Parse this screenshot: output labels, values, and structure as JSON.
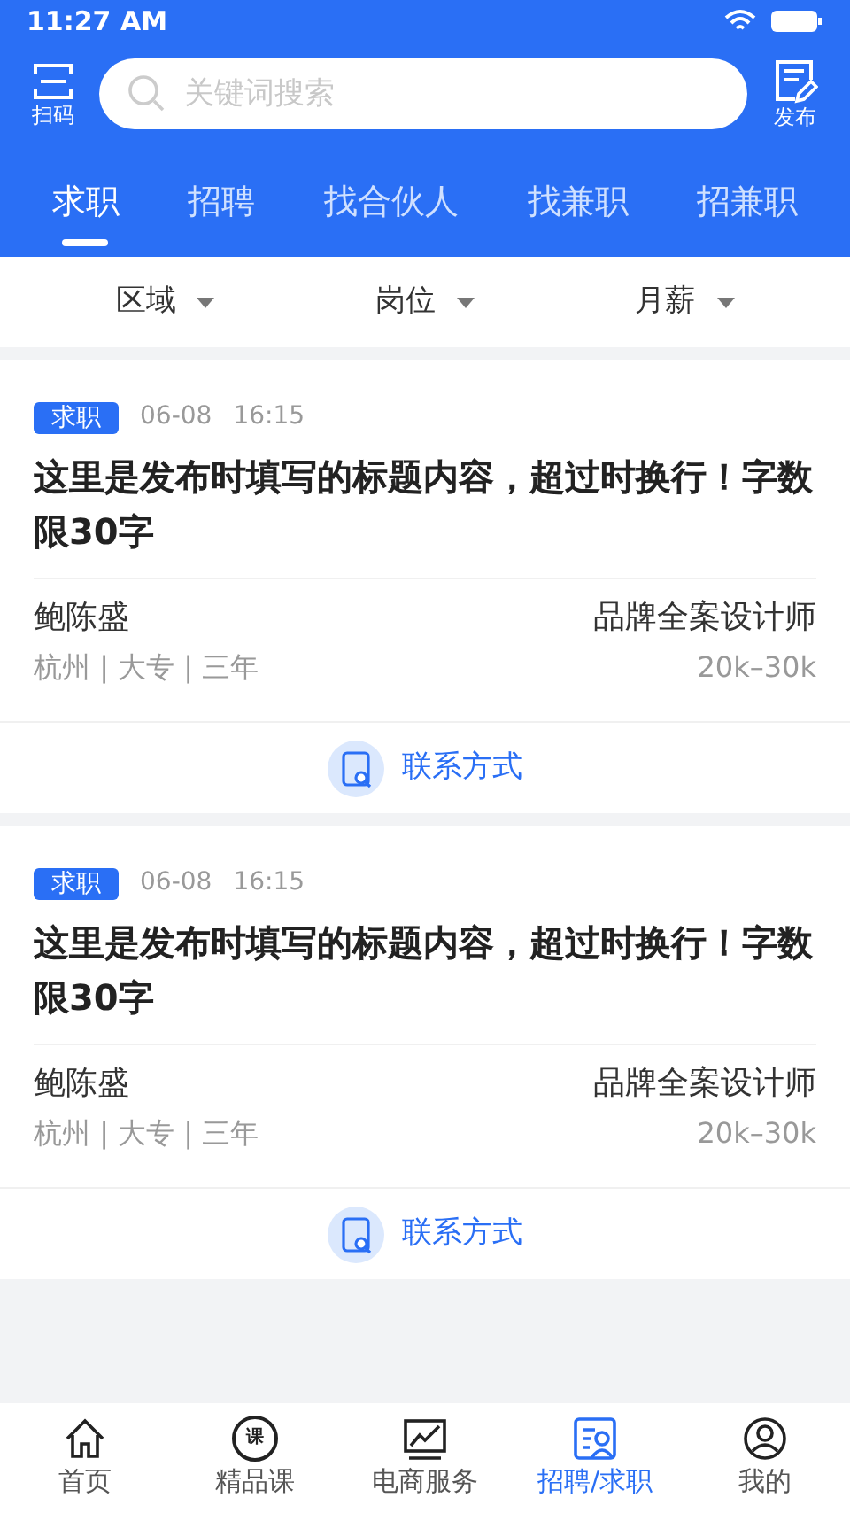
{
  "status_bar": {
    "time": "11:27 AM"
  },
  "header": {
    "scan_label": "扫码",
    "search": {
      "placeholder": "关键词搜索"
    },
    "publish_label": "发布"
  },
  "tabs": [
    {
      "label": "求职",
      "selected": true
    },
    {
      "label": "招聘",
      "selected": false
    },
    {
      "label": "找合伙人",
      "selected": false
    },
    {
      "label": "找兼职",
      "selected": false
    },
    {
      "label": "招兼职",
      "selected": false
    }
  ],
  "filters": [
    {
      "label": "区域"
    },
    {
      "label": "岗位"
    },
    {
      "label": "月薪"
    }
  ],
  "posts": [
    {
      "tag": "求职",
      "date": "06-08",
      "time": "16:15",
      "title": "这里是发布时填写的标题内容，超过时换行！字数限30字",
      "name": "鲍陈盛",
      "details": "杭州 | 大专 | 三年",
      "position": "品牌全案设计师",
      "salary": "20k–30k",
      "contact": "联系方式"
    },
    {
      "tag": "求职",
      "date": "06-08",
      "time": "16:15",
      "title": "这里是发布时填写的标题内容，超过时换行！字数限30字",
      "name": "鲍陈盛",
      "details": "杭州 | 大专 | 三年",
      "position": "品牌全案设计师",
      "salary": "20k–30k",
      "contact": "联系方式"
    }
  ],
  "bottom_nav": [
    {
      "kind": "home",
      "label": "首页",
      "selected": false
    },
    {
      "kind": "course",
      "label": "精品课",
      "icon_text": "课",
      "selected": false
    },
    {
      "kind": "chart",
      "label": "电商服务",
      "selected": false
    },
    {
      "kind": "jobs",
      "label": "招聘/求职",
      "selected": true
    },
    {
      "kind": "profile",
      "label": "我的",
      "selected": false
    }
  ]
}
